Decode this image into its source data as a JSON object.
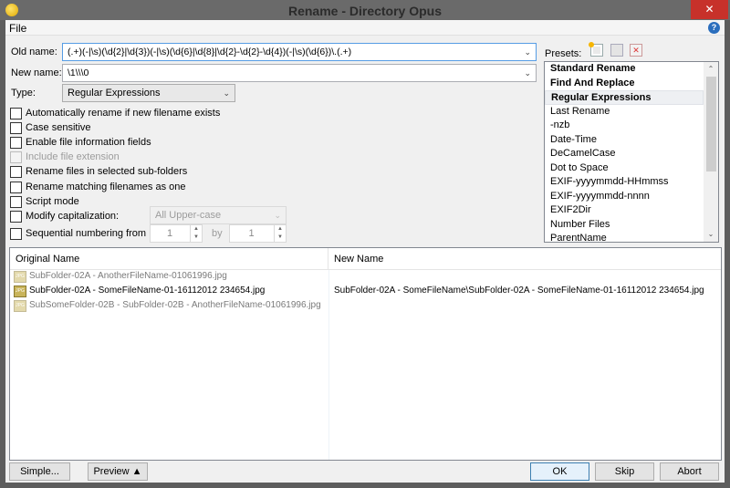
{
  "window": {
    "title": "Rename - Directory Opus",
    "close_label": "✕"
  },
  "menu": {
    "file": "File",
    "help": "?"
  },
  "form": {
    "old_name_label": "Old name:",
    "old_name_value": "(.+)(-|\\s)(\\d{2}|\\d{3})(-|\\s)(\\d{6}|\\d{8}|\\d{2}-\\d{2}-\\d{4})(-|\\s)(\\d{6})\\.(.+)",
    "new_name_label": "New name:",
    "new_name_value": "\\1\\\\\\0",
    "type_label": "Type:",
    "type_value": "Regular Expressions"
  },
  "options": [
    {
      "label": "Automatically rename if new filename exists",
      "checked": false,
      "enabled": true
    },
    {
      "label": "Case sensitive",
      "checked": false,
      "enabled": true
    },
    {
      "label": "Enable file information fields",
      "checked": false,
      "enabled": true
    },
    {
      "label": "Include file extension",
      "checked": false,
      "enabled": false
    },
    {
      "label": "Rename files in selected sub-folders",
      "checked": false,
      "enabled": true
    },
    {
      "label": "Rename matching filenames as one",
      "checked": false,
      "enabled": true
    },
    {
      "label": "Script mode",
      "checked": false,
      "enabled": true
    },
    {
      "label": "Modify capitalization:",
      "checked": false,
      "enabled": true
    },
    {
      "label": "Sequential numbering from",
      "checked": false,
      "enabled": true
    }
  ],
  "capitalization_value": "All Upper-case",
  "sequence": {
    "from": "1",
    "by_label": "by",
    "by": "1"
  },
  "presets": {
    "label": "Presets:",
    "icons": [
      "new-preset-icon",
      "edit-preset-icon",
      "delete-preset-icon"
    ],
    "items": [
      {
        "label": "Standard Rename",
        "bold": true
      },
      {
        "label": "Find And Replace",
        "bold": true
      },
      {
        "label": "Regular Expressions",
        "bold": true,
        "selected": true
      },
      {
        "label": "Last Rename"
      },
      {
        "label": "-nzb"
      },
      {
        "label": "Date-Time"
      },
      {
        "label": "DeCamelCase"
      },
      {
        "label": "Dot to Space"
      },
      {
        "label": "EXIF-yyyymmdd-HHmmss"
      },
      {
        "label": "EXIF-yyyymmdd-nnnn"
      },
      {
        "label": "EXIF2Dir"
      },
      {
        "label": "Number Files"
      },
      {
        "label": "ParentName"
      }
    ]
  },
  "preview": {
    "columns": [
      "Original Name",
      "New Name"
    ],
    "rows": [
      {
        "original": "SubFolder-02A - AnotherFileName-01061996.jpg",
        "new": "",
        "match": false
      },
      {
        "original": "SubFolder-02A - SomeFileName-01-16112012 234654.jpg",
        "new": "SubFolder-02A - SomeFileName\\SubFolder-02A - SomeFileName-01-16112012 234654.jpg",
        "match": true
      },
      {
        "original": "SubSomeFolder-02B - SubFolder-02B - AnotherFileName-01061996.jpg",
        "new": "",
        "match": false
      }
    ]
  },
  "buttons": {
    "simple": "Simple...",
    "preview": "Preview ▲",
    "ok": "OK",
    "skip": "Skip",
    "abort": "Abort"
  }
}
